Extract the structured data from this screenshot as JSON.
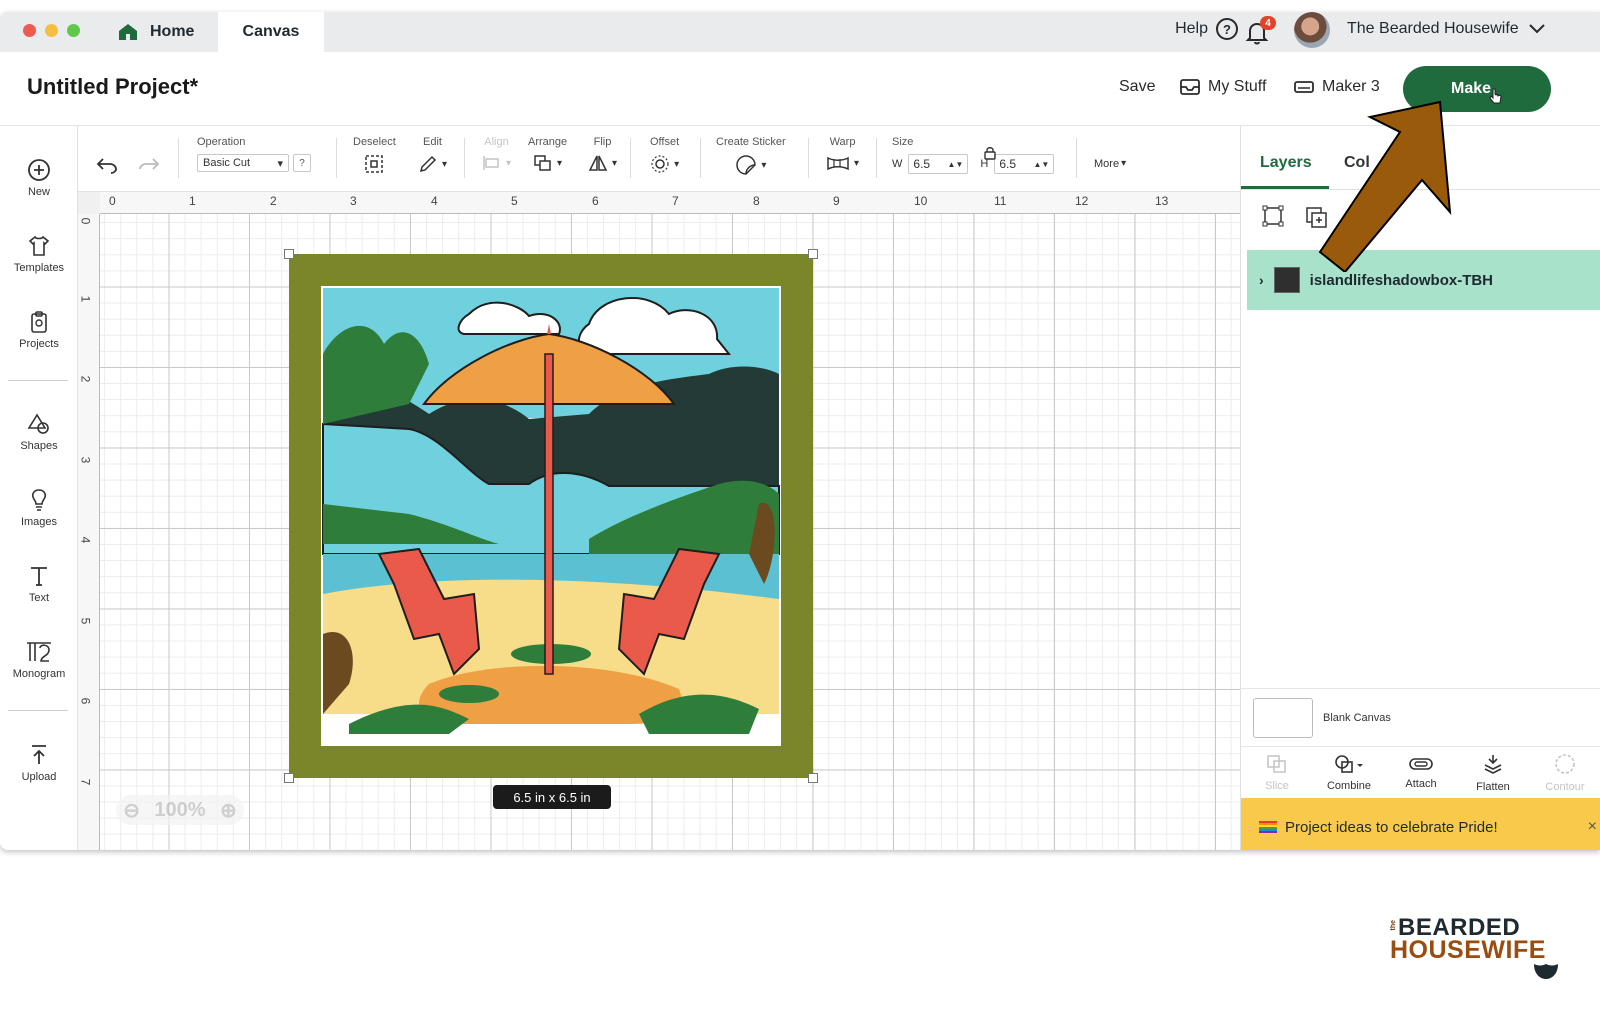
{
  "titlebar": {
    "tabs": [
      {
        "label": "Home"
      },
      {
        "label": "Canvas"
      }
    ],
    "help_label": "Help",
    "help_glyph": "?",
    "notification_count": "4",
    "user_name": "The Bearded Housewife"
  },
  "header": {
    "project_title": "Untitled Project*",
    "save_label": "Save",
    "mystuff_label": "My Stuff",
    "machine_label": "Maker 3",
    "make_label": "Make"
  },
  "leftbar": {
    "items": [
      {
        "label": "New",
        "icon": "plus-circle-icon"
      },
      {
        "label": "Templates",
        "icon": "shirt-icon"
      },
      {
        "label": "Projects",
        "icon": "clipboard-icon"
      },
      {
        "label": "Shapes",
        "icon": "shapes-icon"
      },
      {
        "label": "Images",
        "icon": "lightbulb-icon"
      },
      {
        "label": "Text",
        "icon": "text-icon"
      },
      {
        "label": "Monogram",
        "icon": "monogram-icon"
      },
      {
        "label": "Upload",
        "icon": "upload-icon"
      }
    ]
  },
  "toolbar": {
    "operation_label": "Operation",
    "operation_value": "Basic Cut",
    "operation_help": "?",
    "deselect_label": "Deselect",
    "edit_label": "Edit",
    "align_label": "Align",
    "arrange_label": "Arrange",
    "flip_label": "Flip",
    "offset_label": "Offset",
    "create_sticker_label": "Create Sticker",
    "warp_label": "Warp",
    "size_label": "Size",
    "w_label": "W",
    "w_value": "6.5",
    "h_label": "H",
    "h_value": "6.5",
    "more_label": "More"
  },
  "canvas": {
    "ruler_top": [
      "0",
      "1",
      "2",
      "3",
      "4",
      "5",
      "6",
      "7",
      "8",
      "9",
      "10",
      "11",
      "12",
      "13"
    ],
    "ruler_left": [
      "0",
      "1",
      "2",
      "3",
      "4",
      "5",
      "6",
      "7"
    ],
    "size_tag": "6.5  in x 6.5  in",
    "zoom_level": "100%"
  },
  "rpanel": {
    "tab_layers": "Layers",
    "tab_color": "Col",
    "layer_name": "islandlifeshadowbox-TBH",
    "blank_canvas_label": "Blank Canvas",
    "tools": [
      {
        "label": "Slice",
        "enabled": false
      },
      {
        "label": "Combine",
        "enabled": true
      },
      {
        "label": "Attach",
        "enabled": true
      },
      {
        "label": "Flatten",
        "enabled": true
      },
      {
        "label": "Contour",
        "enabled": false
      }
    ],
    "banner_text": "Project ideas to celebrate Pride!",
    "banner_close": "×"
  },
  "branding": {
    "small": "the",
    "line1": "BEARDED",
    "line2": "HOUSEWIFE"
  },
  "colors": {
    "make_button": "#1f6b3e",
    "layer_highlight": "#a8e2cb",
    "banner": "#f8c94b",
    "annotation_arrow": "#9a5a0c"
  }
}
